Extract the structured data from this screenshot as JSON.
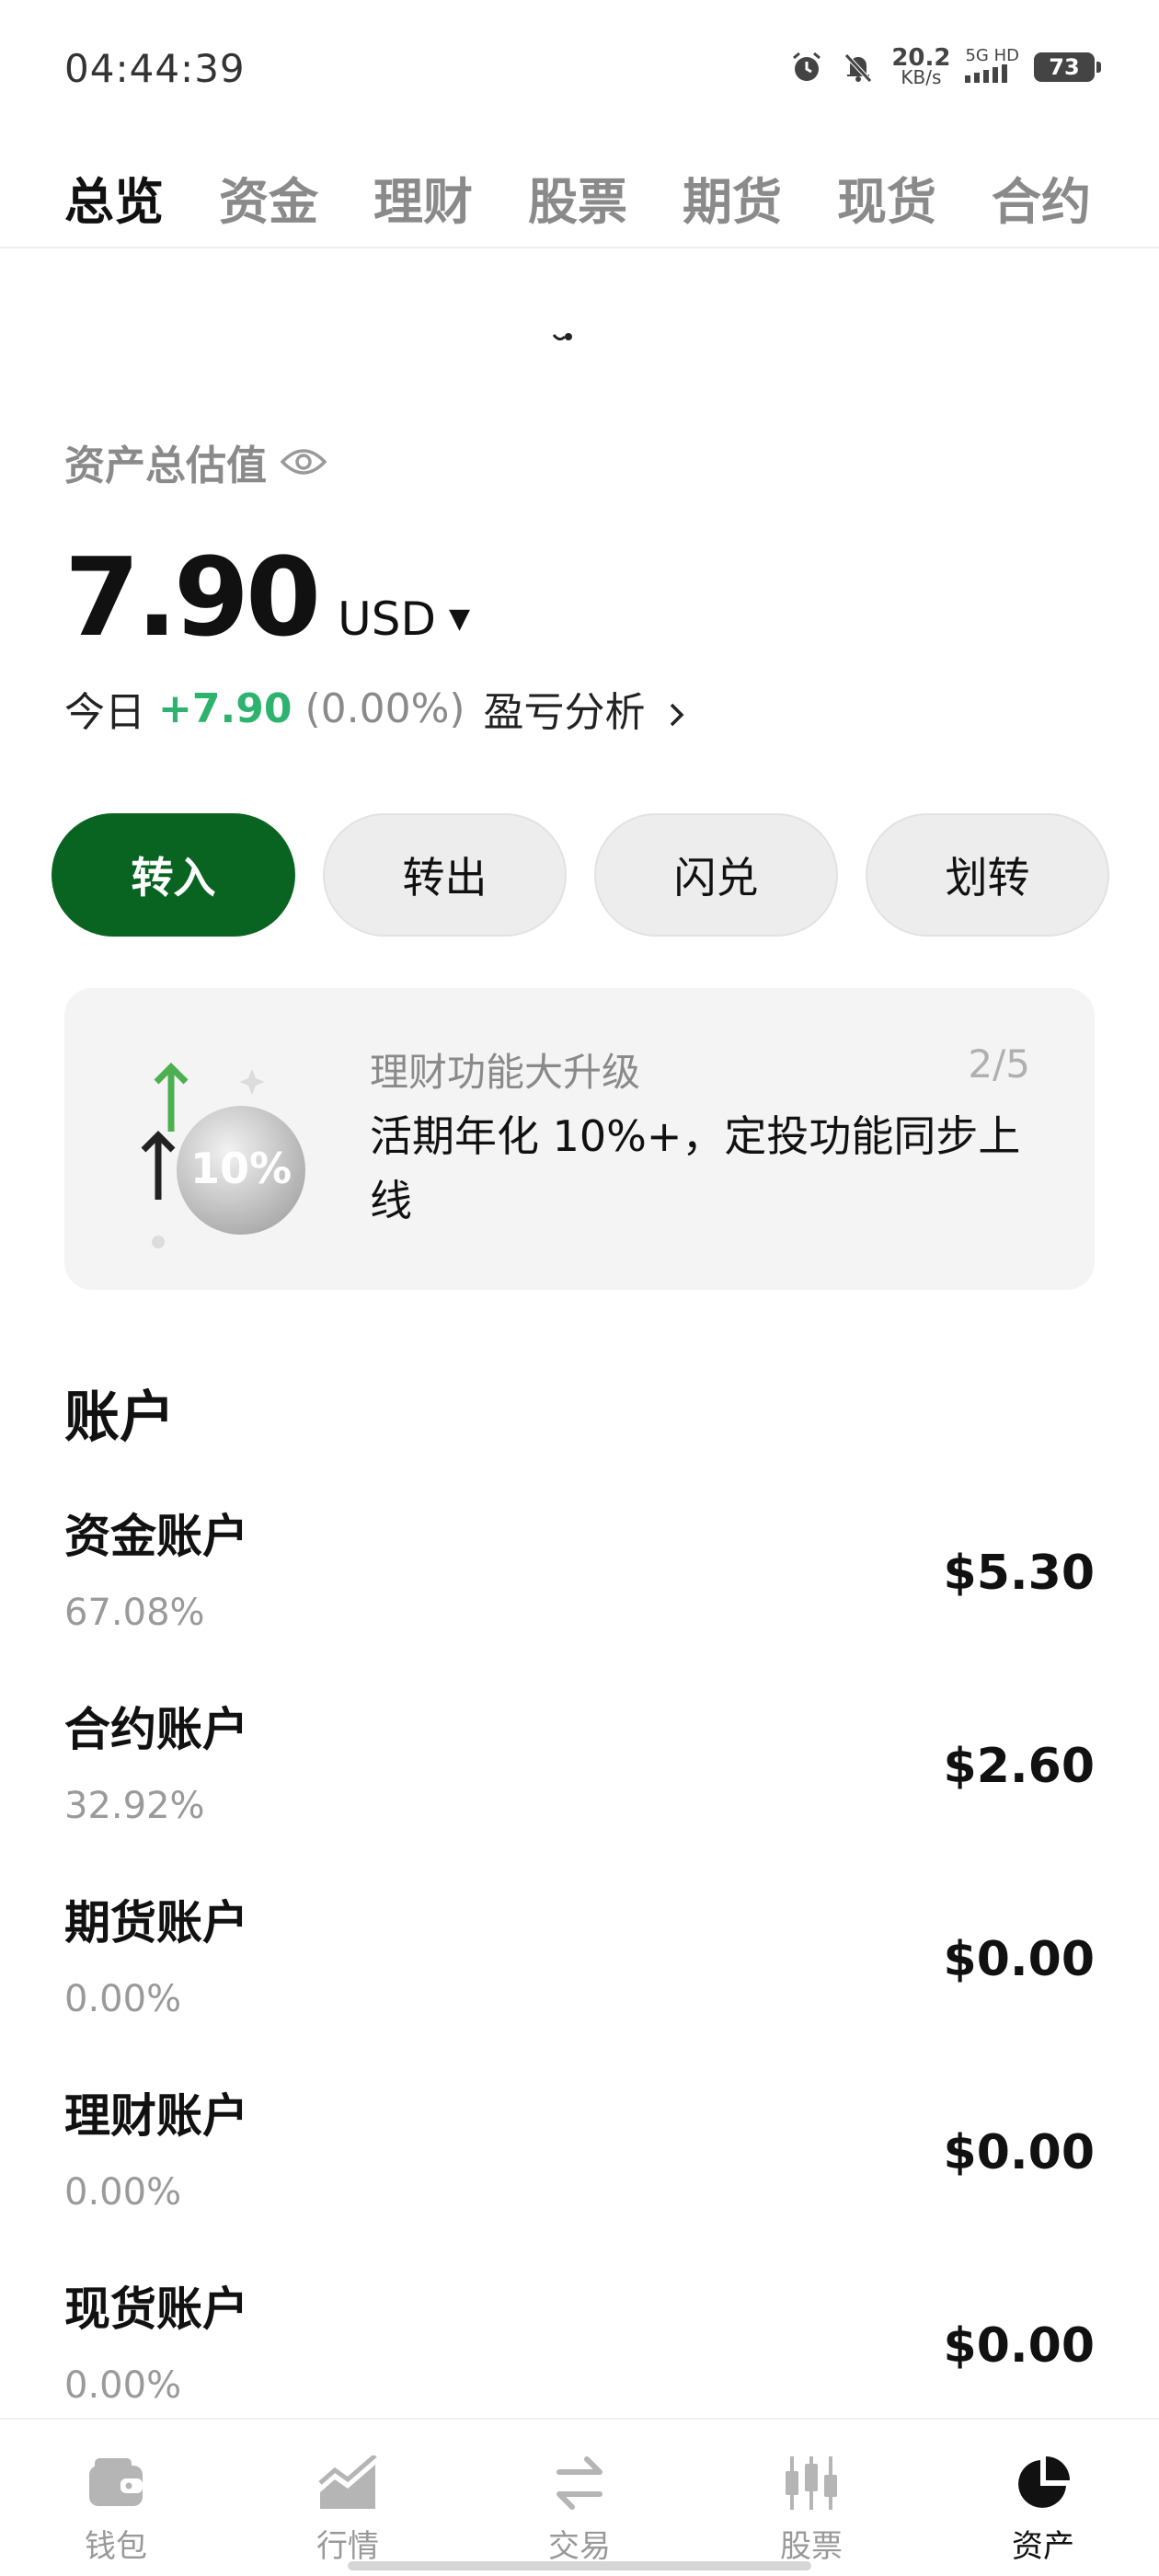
{
  "status_bar": {
    "time": "04:44:39",
    "speed_value": "20.2",
    "speed_unit": "KB/s",
    "network": "5G HD",
    "battery": "73",
    "icons": [
      "alarm-icon",
      "mute-icon"
    ]
  },
  "top_tabs": [
    {
      "label": "总览",
      "active": true
    },
    {
      "label": "资金",
      "active": false
    },
    {
      "label": "理财",
      "active": false
    },
    {
      "label": "股票",
      "active": false
    },
    {
      "label": "期货",
      "active": false
    },
    {
      "label": "现货",
      "active": false
    },
    {
      "label": "合约",
      "active": false
    }
  ],
  "summary": {
    "label": "资产总估值",
    "value": "7.90",
    "currency": "USD",
    "today_label": "今日",
    "today_change": "+7.90",
    "today_pct": "(0.00%)",
    "pnl_link": "盈亏分析"
  },
  "actions": {
    "deposit": "转入",
    "withdraw": "转出",
    "convert": "闪兑",
    "transfer": "划转"
  },
  "promo": {
    "title": "理财功能大升级",
    "page": "2/5",
    "text": "活期年化 10%+，定投功能同步上线",
    "badge": "10%"
  },
  "accounts": {
    "title": "账户",
    "items": [
      {
        "name": "资金账户",
        "pct": "67.08%",
        "value": "$5.30"
      },
      {
        "name": "合约账户",
        "pct": "32.92%",
        "value": "$2.60"
      },
      {
        "name": "期货账户",
        "pct": "0.00%",
        "value": "$0.00"
      },
      {
        "name": "理财账户",
        "pct": "0.00%",
        "value": "$0.00"
      },
      {
        "name": "现货账户",
        "pct": "0.00%",
        "value": "$0.00"
      }
    ]
  },
  "bottom_nav": [
    {
      "label": "钱包",
      "icon": "wallet-icon",
      "active": false
    },
    {
      "label": "行情",
      "icon": "market-chart-icon",
      "active": false
    },
    {
      "label": "交易",
      "icon": "trade-swap-icon",
      "active": false
    },
    {
      "label": "股票",
      "icon": "candlestick-icon",
      "active": false
    },
    {
      "label": "资产",
      "icon": "pie-chart-icon",
      "active": true
    }
  ],
  "colors": {
    "primary_green": "#0a6421",
    "profit_green": "#2db36e",
    "muted_text": "#8a8a8a"
  }
}
